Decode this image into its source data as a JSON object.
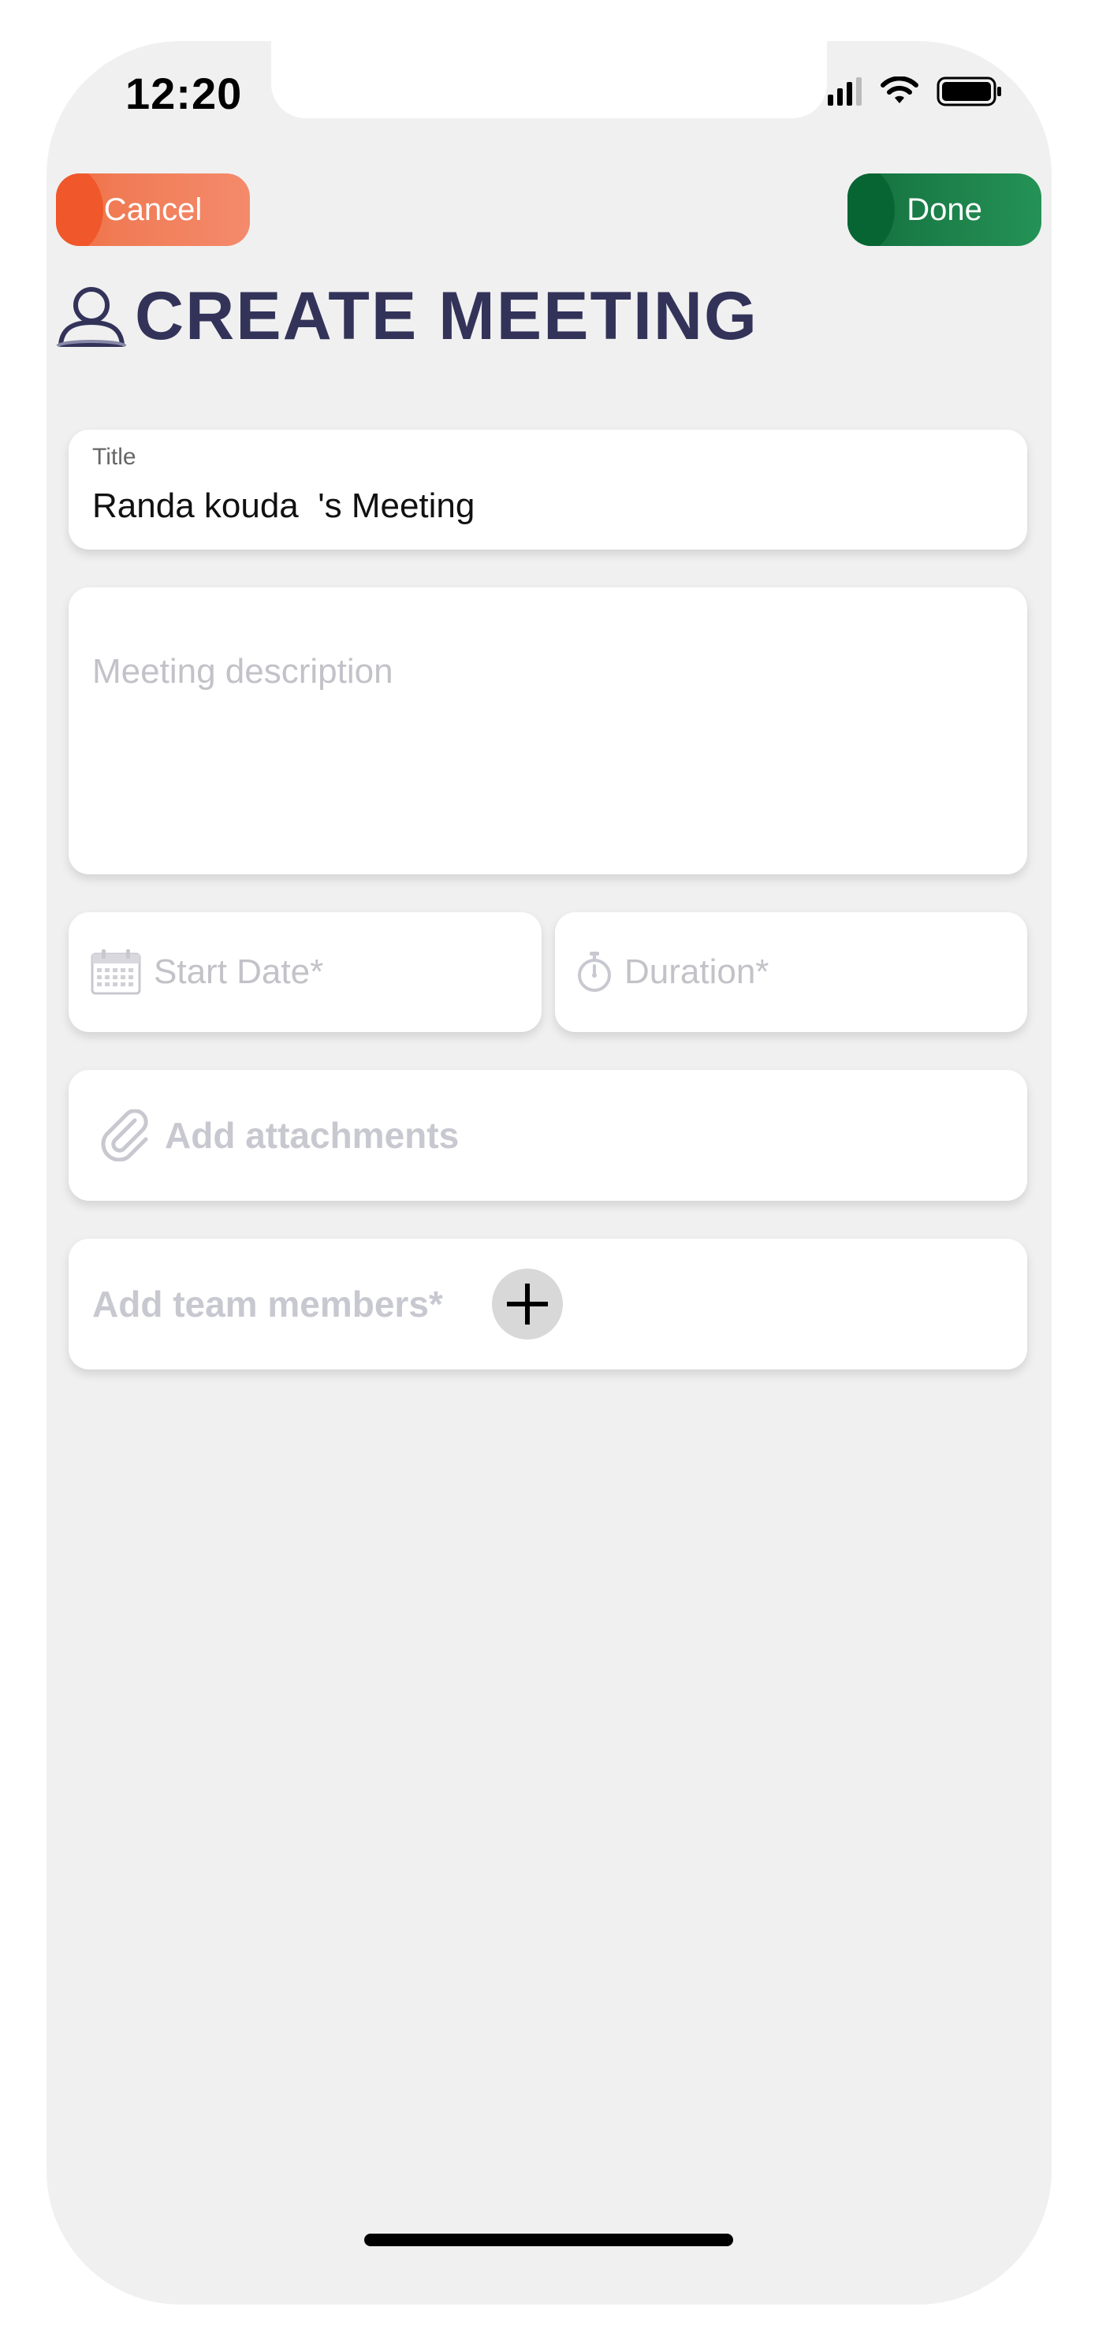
{
  "status_bar": {
    "time": "12:20"
  },
  "header": {
    "cancel_label": "Cancel",
    "done_label": "Done",
    "title": "CREATE MEETING",
    "title_icon": "user-icon"
  },
  "form": {
    "title": {
      "label": "Title",
      "value": "Randa kouda  's Meeting"
    },
    "description": {
      "placeholder": "Meeting description",
      "value": ""
    },
    "start_date": {
      "placeholder": "Start Date*",
      "icon": "calendar-icon"
    },
    "duration": {
      "placeholder": "Duration*",
      "icon": "stopwatch-icon"
    },
    "attachments": {
      "label": "Add attachments",
      "icon": "paperclip-icon"
    },
    "team_members": {
      "label": "Add team members*",
      "icon": "plus-icon"
    }
  },
  "colors": {
    "cancel": "#f26a3a",
    "done": "#197a45",
    "title": "#33335a",
    "background": "#f0f0f0",
    "placeholder": "#c8c8d0"
  }
}
